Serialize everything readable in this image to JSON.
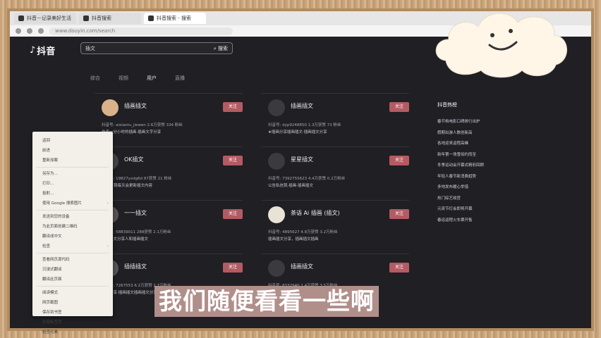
{
  "browser": {
    "tabs": [
      "抖音－记录美好生活",
      "抖音搜索",
      "抖音搜索 - 搜索"
    ],
    "url": "www.douyin.com/search"
  },
  "app": {
    "logo": "抖音"
  },
  "search": {
    "value": "插文",
    "button": "搜索"
  },
  "nav_tabs": [
    "综合",
    "视频",
    "用户",
    "直播"
  ],
  "users": [
    {
      "name": "插画插文",
      "follow": "关注",
      "meta": "抖音号: aixiaotu_jiewen   2.6万获赞   334 粉丝",
      "desc": "作者一分小时的插画·插画文字分享"
    },
    {
      "name": "插画插文",
      "follow": "关注",
      "meta": "抖音号: dyp9248850   1.3万获赞   73 粉丝",
      "desc": "★插画分享插画插文·插画插文分享"
    },
    {
      "name": "OK插文",
      "follow": "关注",
      "meta": "抖音号: 19827yxdg6d   87获赞   21 粉丝",
      "desc": "(插画) 我每天会更新插文内容"
    },
    {
      "name": "星星插文",
      "follow": "关注",
      "meta": "抖音号: 7392755623   4.4万获赞   0.2万粉丝",
      "desc": "公告私信我·插画·插画插文"
    },
    {
      "name": "一一插文",
      "follow": "关注",
      "meta": "抖音号: 58839011   288获赞   2.1万粉丝",
      "desc": "插画插文分享人和插画插文"
    },
    {
      "name": "茶语 Ai 插画 (插文)",
      "follow": "关注",
      "meta": "抖音号: 4895627   4.8万获赞   3.2万粉丝",
      "desc": "插画插文分享，插画插文插画"
    },
    {
      "name": "插插插文",
      "follow": "关注",
      "meta": "抖音号: 7267553   6.2万获赞   2.7万粉丝",
      "desc": "插画分享·插画插文插画插文分享"
    },
    {
      "name": "插画插文",
      "follow": "关注",
      "meta": "抖音号: 8332940   1.4万获赞   3.5万粉丝",
      "desc": "插画插文插画插文分享"
    }
  ],
  "hot": {
    "title": "抖音热榜",
    "items": [
      "春节档电影口碑排行出炉",
      "假期出游人数创新高",
      "各地迎来返程高峰",
      "新年第一场雪如约而至",
      "冬季运动会开幕式精彩回顾",
      "年轻人春节新消费趋势",
      "多地发布暖心举措",
      "热门综艺收官",
      "元宵节灯会即将开幕",
      "春运返程火车票开售"
    ]
  },
  "context_menu": {
    "items": [
      "返回",
      "前进",
      "重新加载",
      "另存为...",
      "打印...",
      "投射...",
      "使用 Google 搜索图片",
      "发送到您的设备",
      "为此页面创建二维码",
      "翻译成中文",
      "检查",
      "查看网页源代码",
      "沉浸式翻译",
      "翻译此页面",
      "阅读模式",
      "网页截图",
      "保存到书签",
      "全部标签页",
      "检查元素"
    ]
  },
  "subtitle": "我们随便看看一些啊",
  "colors": {
    "accent": "#b45a62",
    "page_bg": "#1f1f24"
  }
}
